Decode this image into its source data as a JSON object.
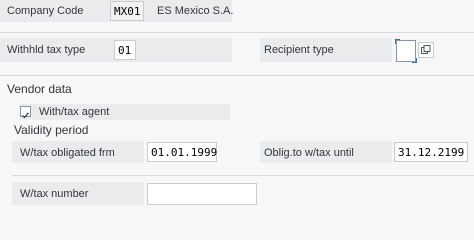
{
  "company": {
    "label": "Company Code",
    "code": "MX01",
    "name": "ES Mexico S.A."
  },
  "withholding": {
    "type_label": "Withhld tax type",
    "type_value": "01",
    "recipient_label": "Recipient type",
    "recipient_value": ""
  },
  "vendor": {
    "section_title": "Vendor data",
    "agent_label": "With/tax agent",
    "agent_checked": true
  },
  "validity": {
    "section_title": "Validity period",
    "from_label": "W/tax obligated frm",
    "from_value": "01.01.1999",
    "until_label": "Oblig.to w/tax until",
    "until_value": "31.12.2199"
  },
  "number": {
    "label": "W/tax number",
    "value": ""
  }
}
